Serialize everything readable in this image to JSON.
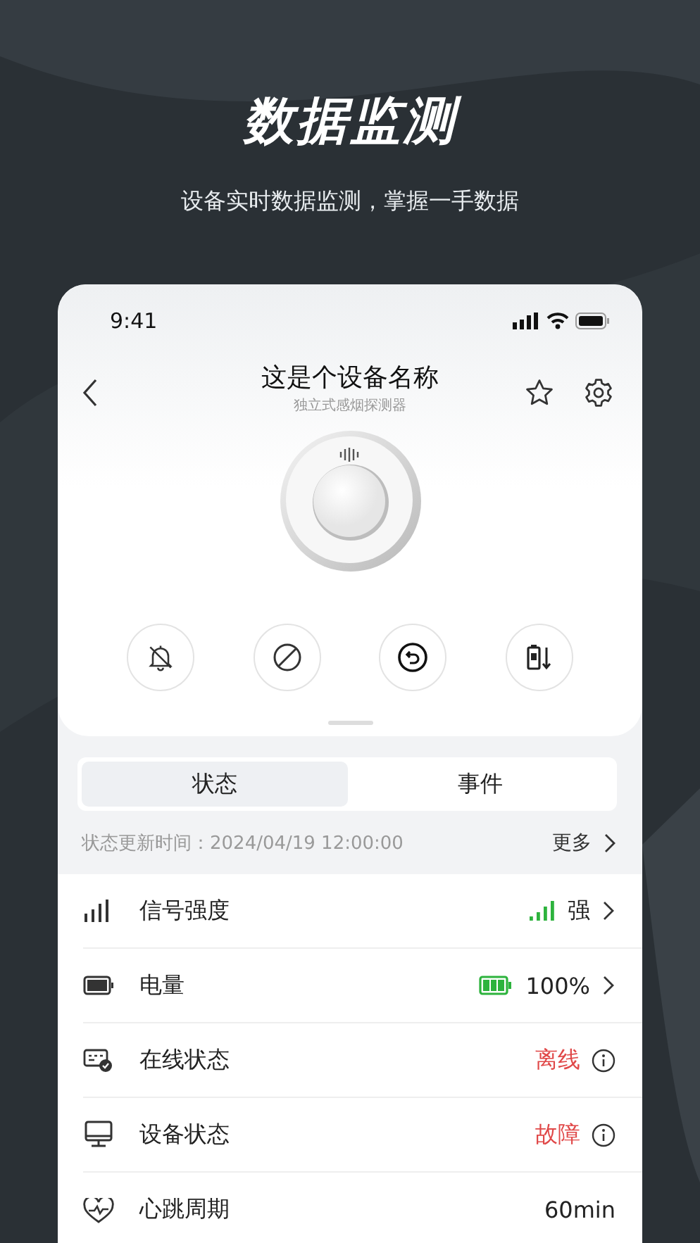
{
  "promo": {
    "title": "数据监测",
    "subtitle": "设备实时数据监测，掌握一手数据"
  },
  "status_bar": {
    "time": "9:41"
  },
  "header": {
    "title": "这是个设备名称",
    "subtitle": "独立式感烟探测器"
  },
  "tabs": [
    {
      "label": "状态",
      "selected": true
    },
    {
      "label": "事件",
      "selected": false
    }
  ],
  "update": {
    "text": "状态更新时间：2024/04/19 12:00:00",
    "more": "更多"
  },
  "rows": [
    {
      "kind": "signal",
      "label": "信号强度",
      "value": "强",
      "alert": false,
      "chevron": true,
      "info": false
    },
    {
      "kind": "battery",
      "label": "电量",
      "value": "100%",
      "alert": false,
      "chevron": true,
      "info": false
    },
    {
      "kind": "online",
      "label": "在线状态",
      "value": "离线",
      "alert": true,
      "chevron": false,
      "info": true
    },
    {
      "kind": "device",
      "label": "设备状态",
      "value": "故障",
      "alert": true,
      "chevron": false,
      "info": true
    },
    {
      "kind": "heartbeat",
      "label": "心跳周期",
      "value": "60min",
      "alert": false,
      "chevron": false,
      "info": false
    }
  ]
}
